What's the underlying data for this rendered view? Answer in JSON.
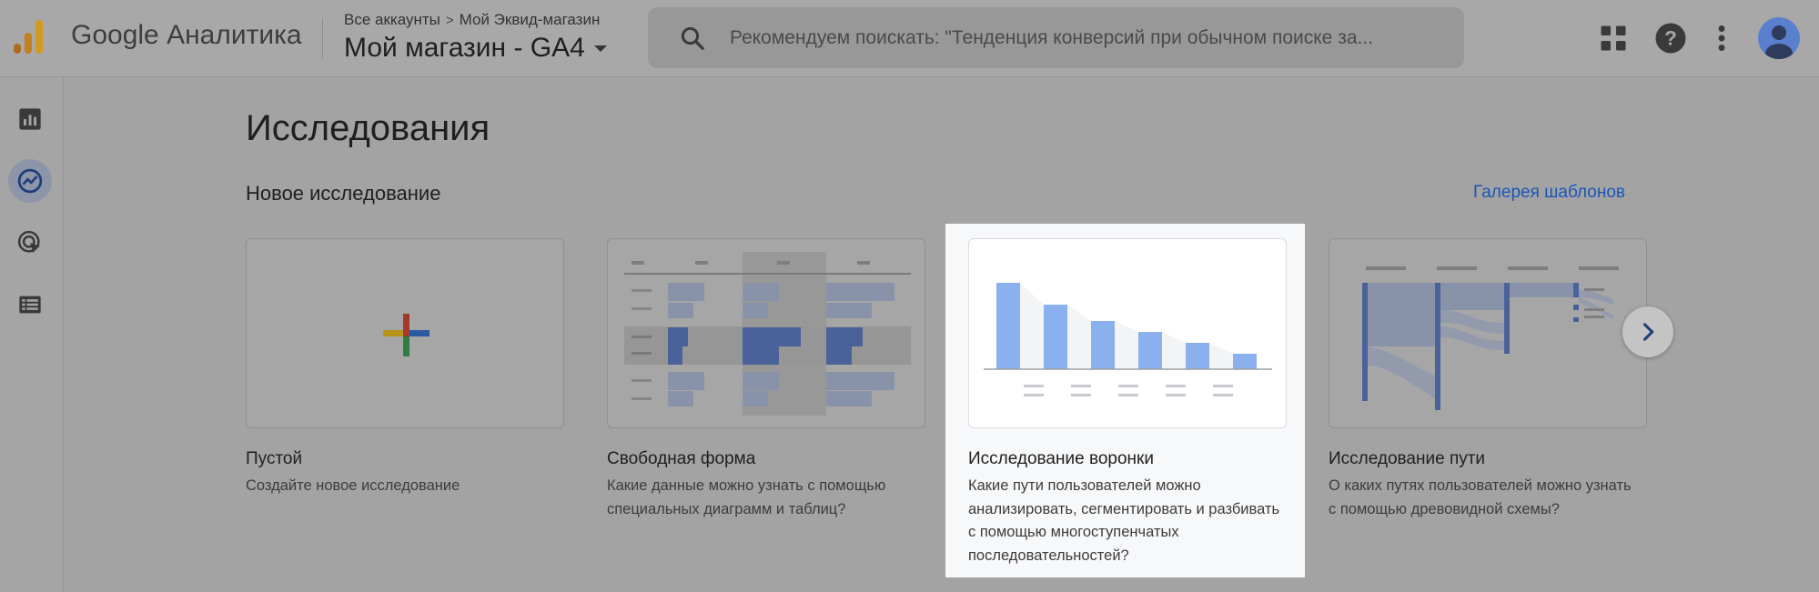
{
  "header": {
    "app_name": "Google Аналитика",
    "breadcrumb": {
      "root": "Все аккаунты",
      "separator": ">",
      "account": "Мой Эквид-магазин"
    },
    "property": "Мой магазин - GA4",
    "search_placeholder": "Рекомендуем поискать: \"Тенденция конверсий при обычном поиске за...",
    "icons": [
      "apps-grid-icon",
      "help-icon",
      "more-vert-icon",
      "account-avatar"
    ]
  },
  "rail": {
    "items": [
      {
        "name": "reports-icon",
        "active": false
      },
      {
        "name": "explore-icon",
        "active": true
      },
      {
        "name": "advertising-icon",
        "active": false
      },
      {
        "name": "configure-icon",
        "active": false
      }
    ]
  },
  "main": {
    "title": "Исследования",
    "section_title": "Новое исследование",
    "gallery_link": "Галерея шаблонов",
    "cards": [
      {
        "title": "Пустой",
        "desc": "Создайте новое исследование"
      },
      {
        "title": "Свободная форма",
        "desc": "Какие данные можно узнать с помощью специальных диаграмм и таблиц?"
      },
      {
        "title": "Исследование воронки",
        "desc": "Какие пути пользователей можно анализировать, сегментировать и разбивать с помощью многоступенчатых последовательностей?"
      },
      {
        "title": "Исследование пути",
        "desc": "О каких путях пользователей можно узнать с помощью древовидной схемы?"
      }
    ]
  },
  "colors": {
    "accent_blue": "#1a56b8",
    "funnel_bar": "#8ab0ee",
    "overlay_gray": "#a3a3a3",
    "highlight_bg": "#f7f8fa"
  }
}
